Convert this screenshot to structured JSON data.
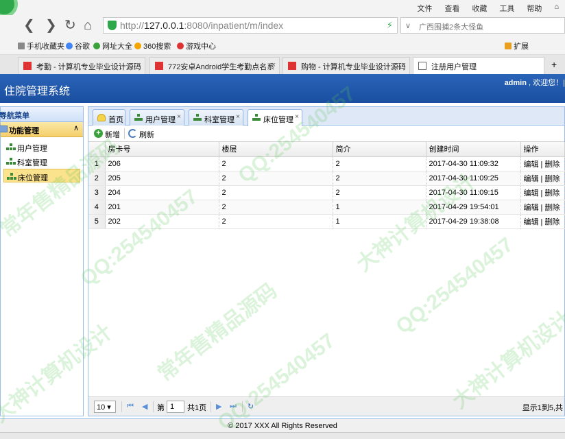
{
  "browser": {
    "menu": [
      "文件",
      "查看",
      "收藏",
      "工具",
      "帮助"
    ],
    "url_prefix": "http://",
    "url_host": "127.0.0.1",
    "url_rest": ":8080/inpatient/m/index",
    "search_placeholder": "广西围捕2条大怪鱼",
    "bookmarks": [
      "手机收藏夹",
      "谷歌",
      "网址大全",
      "360搜索",
      "游戏中心"
    ],
    "extensions_label": "扩展",
    "tabs": [
      {
        "title": "考勤 - 计算机专业毕业设计源码"
      },
      {
        "title": "772安卓Android学生考勤点名系"
      },
      {
        "title": "购物 - 计算机专业毕业设计源码"
      },
      {
        "title": "注册用户管理"
      }
    ]
  },
  "app": {
    "title": "住院管理系统",
    "user": "admin",
    "welcome": "欢迎您！|"
  },
  "sidebar": {
    "header": "导航菜单",
    "group": "功能管理",
    "items": [
      {
        "label": "用户管理"
      },
      {
        "label": "科室管理"
      },
      {
        "label": "床位管理"
      }
    ]
  },
  "main": {
    "tabs": [
      {
        "label": "首页"
      },
      {
        "label": "用户管理"
      },
      {
        "label": "科室管理"
      },
      {
        "label": "床位管理"
      }
    ],
    "toolbar": {
      "add": "新增",
      "refresh": "刷新"
    },
    "columns": [
      "房卡号",
      "楼层",
      "简介",
      "创建时间",
      "操作"
    ],
    "rows": [
      {
        "n": "1",
        "room": "206",
        "floor": "2",
        "intro": "2",
        "created": "2017-04-30 11:09:32"
      },
      {
        "n": "2",
        "room": "205",
        "floor": "2",
        "intro": "2",
        "created": "2017-04-30 11:09:25"
      },
      {
        "n": "3",
        "room": "204",
        "floor": "2",
        "intro": "2",
        "created": "2017-04-30 11:09:15"
      },
      {
        "n": "4",
        "room": "201",
        "floor": "2",
        "intro": "1",
        "created": "2017-04-29 19:54:01"
      },
      {
        "n": "5",
        "room": "202",
        "floor": "2",
        "intro": "1",
        "created": "2017-04-29 19:38:08"
      }
    ],
    "actions": {
      "edit": "编辑",
      "sep": " | ",
      "delete": "删除"
    },
    "pager": {
      "page_size": "10",
      "page_prefix": "第",
      "page": "1",
      "page_total": "共1页",
      "status": "显示1到5,共"
    }
  },
  "footer": "© 2017 XXX All Rights Reserved",
  "watermarks": [
    "常年售精品源码",
    "QQ:254540457",
    "大神计算机设计"
  ]
}
